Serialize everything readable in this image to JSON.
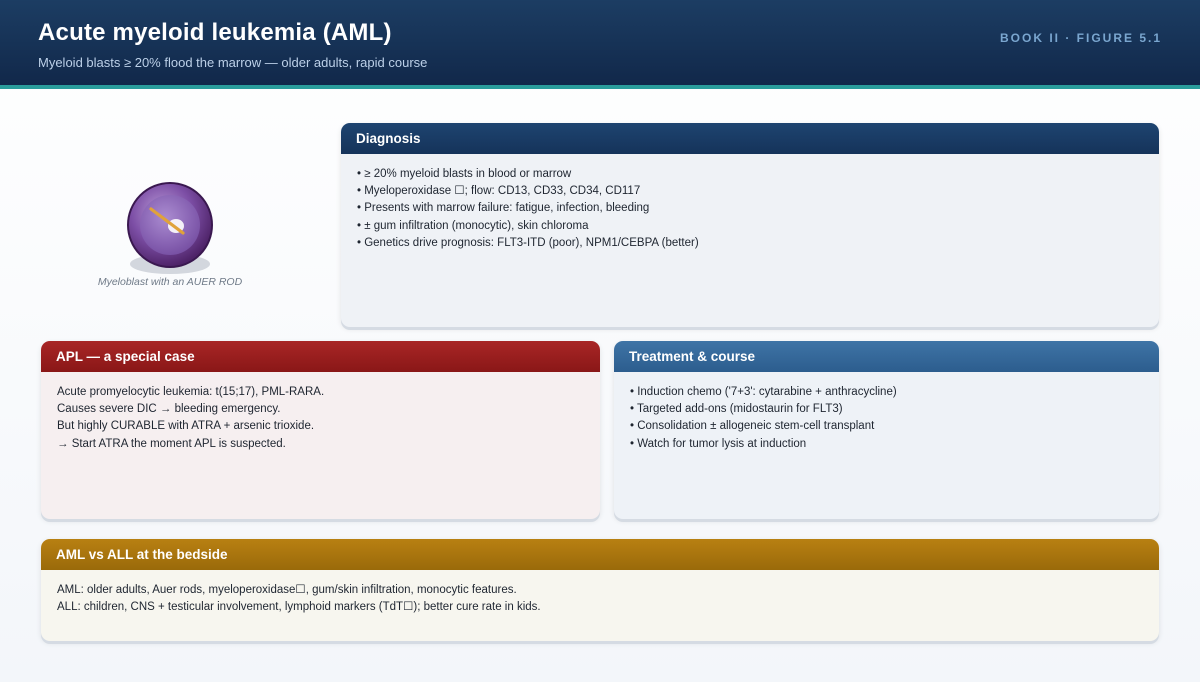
{
  "header": {
    "title": "Acute myeloid leukemia (AML)",
    "subtitle": "Myeloid blasts ≥ 20% flood the marrow — older adults, rapid course",
    "figure_tag": "BOOK II · FIGURE 5.1"
  },
  "illustration": {
    "caption": "Myeloblast with an AUER ROD",
    "colors": {
      "cytoplasm": "#5b2e7a",
      "nucleus": "#9a78c4",
      "auer_rod": "#e0a23a",
      "outline": "#3a1850"
    }
  },
  "diagnosis": {
    "title": "Diagnosis",
    "items": [
      "• ≥ 20% myeloid blasts in blood or marrow",
      "• Myeloperoxidase ☐; flow: CD13, CD33, CD34, CD117",
      "• Presents with marrow failure: fatigue, infection, bleeding",
      "• ± gum infiltration (monocytic), skin chloroma",
      "• Genetics drive prognosis: FLT3-ITD (poor), NPM1/CEBPA (better)"
    ]
  },
  "apl": {
    "title": "APL — a special case",
    "lines": [
      "Acute promyelocytic leukemia: t(15;17), PML-RARA.",
      "Causes severe DIC → bleeding emergency.",
      "But highly CURABLE with ATRA + arsenic trioxide.",
      "→ Start ATRA the moment APL is suspected."
    ]
  },
  "treatment": {
    "title": "Treatment & course",
    "items": [
      "• Induction chemo ('7+3': cytarabine + anthracycline)",
      "• Targeted add-ons (midostaurin for FLT3)",
      "• Consolidation ± allogeneic stem-cell transplant",
      "• Watch for tumor lysis at induction"
    ]
  },
  "compare": {
    "title": "AML vs ALL at the bedside",
    "lines": [
      "AML: older adults, Auer rods, myeloperoxidase☐, gum/skin infiltration, monocytic features.",
      "ALL: children, CNS + testicular involvement, lymphoid markers (TdT☐); better cure rate in kids."
    ]
  },
  "colors": {
    "header": "#15335a",
    "accent_rule": "#2a9d9b",
    "diagnosis": "#1a3c66",
    "apl": "#9a1e1e",
    "treatment": "#346999",
    "compare": "#a87410"
  }
}
